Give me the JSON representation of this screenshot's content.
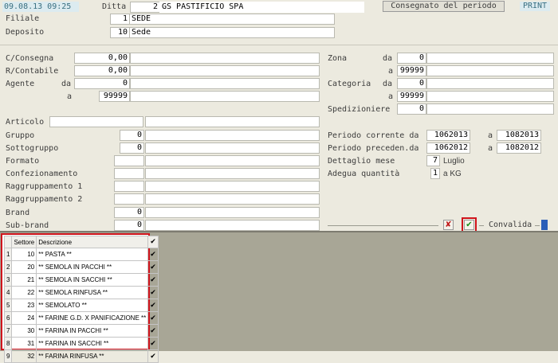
{
  "header": {
    "timestamp": "09.08.13 09:25",
    "ditta_label": "Ditta",
    "ditta_code": "2",
    "ditta_name": "GS PASTIFICIO SPA",
    "consegnato_button": "Consegnato del periodo",
    "print_button": "PRINT",
    "filiale_label": "Filiale",
    "filiale_code": "1",
    "filiale_name": "SEDE",
    "deposito_label": "Deposito",
    "deposito_code": "10",
    "deposito_name": "Sede"
  },
  "left": {
    "cconsegna_label": "C/Consegna",
    "cconsegna_value": "0,00",
    "rcontabile_label": "R/Contabile",
    "rcontabile_value": "0,00",
    "agente_label": "Agente",
    "da_label": "da",
    "a_label": "a",
    "agente_da": "0",
    "agente_a": "99999",
    "articolo_label": "Articolo",
    "gruppo_label": "Gruppo",
    "gruppo_value": "0",
    "sottogruppo_label": "Sottogruppo",
    "sottogruppo_value": "0",
    "formato_label": "Formato",
    "confezionamento_label": "Confezionamento",
    "raggr1_label": "Raggruppamento 1",
    "raggr2_label": "Raggruppamento 2",
    "brand_label": "Brand",
    "brand_value": "0",
    "subbrand_label": "Sub-brand",
    "subbrand_value": "0"
  },
  "right": {
    "zona_label": "Zona",
    "da_label": "da",
    "a_label": "a",
    "zona_da": "0",
    "zona_a": "99999",
    "categoria_label": "Categoria",
    "categoria_da": "0",
    "categoria_a": "99999",
    "spedizioniere_label": "Spedizioniere",
    "spedizioniere_value": "0",
    "periodo_corrente_label": "Periodo corrente da",
    "periodo_corrente_da": "1062013",
    "periodo_corrente_a": "1082013",
    "periodo_preced_label": "Periodo preceden.da",
    "periodo_preced_da": "1062012",
    "periodo_preced_a": "1082012",
    "dettaglio_label": "Dettaglio mese",
    "dettaglio_value": "7",
    "dettaglio_text": "Luglio",
    "adegua_label": "Adegua  quantità",
    "adegua_value": "1",
    "adegua_text": "a KG",
    "convalida_label": "Convalida",
    "cancel_glyph": "✘",
    "confirm_glyph": "✔"
  },
  "grid": {
    "headers": {
      "settore": "Settore",
      "descrizione": "Descrizione",
      "check": "✔"
    },
    "rows": [
      {
        "n": "1",
        "settore": "10",
        "descrizione": "** PASTA **",
        "check": "✔"
      },
      {
        "n": "2",
        "settore": "20",
        "descrizione": "** SEMOLA IN PACCHI **",
        "check": "✔"
      },
      {
        "n": "3",
        "settore": "21",
        "descrizione": "** SEMOLA IN SACCHI **",
        "check": "✔"
      },
      {
        "n": "4",
        "settore": "22",
        "descrizione": "** SEMOLA RINFUSA **",
        "check": "✔"
      },
      {
        "n": "5",
        "settore": "23",
        "descrizione": "** SEMOLATO **",
        "check": "✔"
      },
      {
        "n": "6",
        "settore": "24",
        "descrizione": "** FARINE G.D. X PANIFICAZIONE **",
        "check": "✔"
      },
      {
        "n": "7",
        "settore": "30",
        "descrizione": "** FARINA IN PACCHI **",
        "check": "✔"
      },
      {
        "n": "8",
        "settore": "31",
        "descrizione": "** FARINA IN SACCHI **",
        "check": "✔"
      },
      {
        "n": "9",
        "settore": "32",
        "descrizione": "** FARINA RINFUSA **",
        "check": "✔"
      }
    ]
  },
  "colors": {
    "background": "#eceadf",
    "bottom_area": "#a8a696",
    "highlight_border": "#d0141c",
    "confirm_green": "#1a8f1a",
    "cancel_red": "#c01818",
    "accent_blue": "#2b5fb8"
  },
  "icons": {
    "cancel": "cancel-icon",
    "confirm": "confirm-icon",
    "check": "checkmark-icon"
  }
}
